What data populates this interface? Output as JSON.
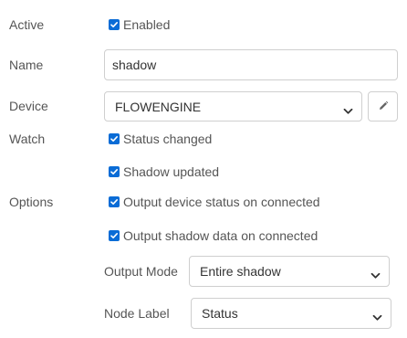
{
  "fields": {
    "active": {
      "label": "Active",
      "checkbox": {
        "label": "Enabled",
        "checked": true
      }
    },
    "name": {
      "label": "Name",
      "value": "shadow"
    },
    "device": {
      "label": "Device",
      "selected": "FLOWENGINE"
    },
    "watch": {
      "label": "Watch",
      "options": [
        {
          "label": "Status changed",
          "checked": true
        },
        {
          "label": "Shadow updated",
          "checked": true
        }
      ]
    },
    "options": {
      "label": "Options",
      "items": [
        {
          "label": "Output device status on connected",
          "checked": true
        },
        {
          "label": "Output shadow data on connected",
          "checked": true
        }
      ]
    },
    "output_mode": {
      "label": "Output Mode",
      "selected": "Entire shadow"
    },
    "node_label": {
      "label": "Node Label",
      "selected": "Status"
    }
  },
  "icons": {
    "checkbox": "checkmark-icon",
    "dropdown": "chevron-down-icon",
    "edit": "pencil-icon"
  },
  "colors": {
    "checkbox_fill": "#0a6cd6",
    "label_text": "#555555",
    "input_text": "#333333",
    "border": "#cfcfcf"
  }
}
